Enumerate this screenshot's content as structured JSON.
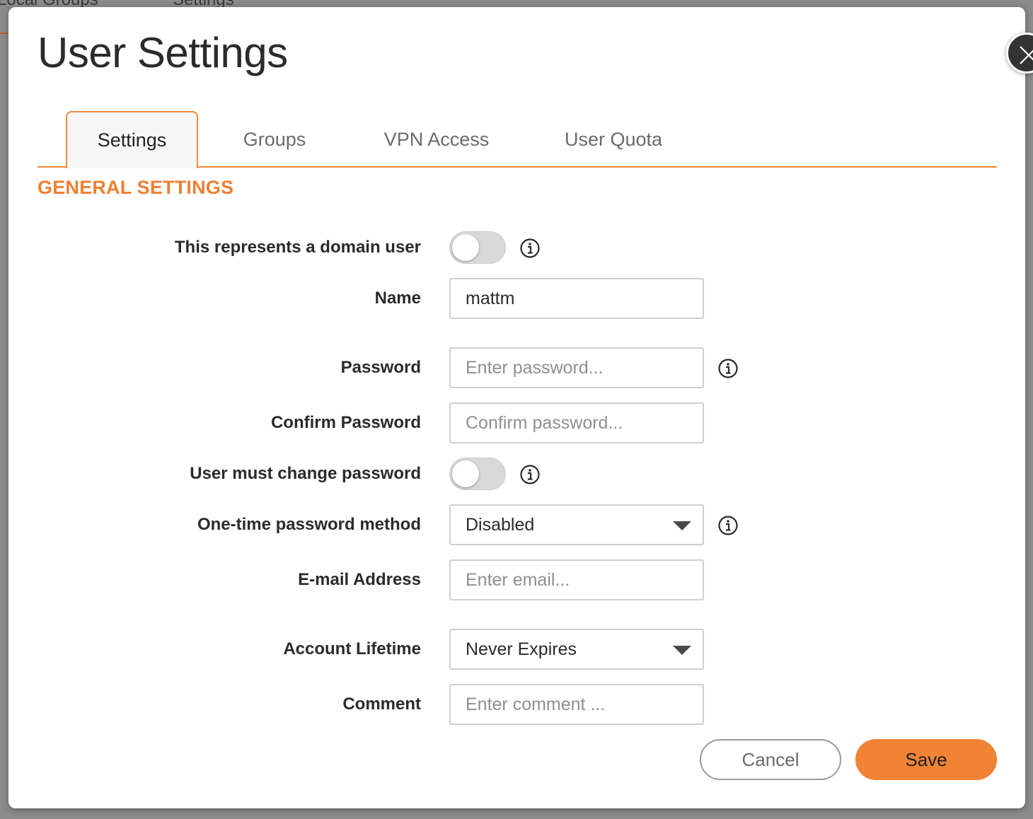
{
  "background": {
    "tabs": [
      "Local Groups",
      "Settings"
    ]
  },
  "modal": {
    "title": "User Settings",
    "close_icon": "close-icon",
    "tabs": [
      {
        "label": "Settings",
        "active": true
      },
      {
        "label": "Groups",
        "active": false
      },
      {
        "label": "VPN Access",
        "active": false
      },
      {
        "label": "User Quota",
        "active": false
      }
    ],
    "section_title": "GENERAL SETTINGS",
    "form": {
      "domain_user": {
        "label": "This represents a domain user",
        "enabled": false
      },
      "name": {
        "label": "Name",
        "value": "mattm"
      },
      "password": {
        "label": "Password",
        "placeholder": "Enter password..."
      },
      "confirm_password": {
        "label": "Confirm Password",
        "placeholder": "Confirm password..."
      },
      "must_change_password": {
        "label": "User must change password",
        "enabled": false
      },
      "otp_method": {
        "label": "One-time password method",
        "value": "Disabled"
      },
      "email": {
        "label": "E-mail Address",
        "placeholder": "Enter email..."
      },
      "account_lifetime": {
        "label": "Account Lifetime",
        "value": "Never Expires"
      },
      "comment": {
        "label": "Comment",
        "placeholder": "Enter comment ..."
      }
    },
    "buttons": {
      "cancel": "Cancel",
      "save": "Save"
    },
    "colors": {
      "accent": "#ef7f32",
      "save_button": "#f08335"
    }
  }
}
